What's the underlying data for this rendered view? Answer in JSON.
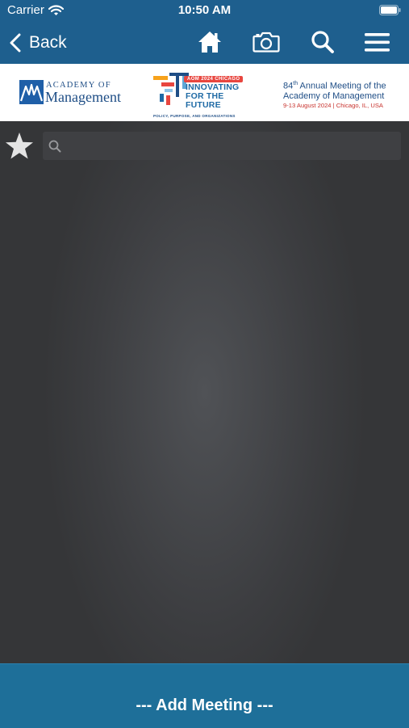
{
  "status_bar": {
    "carrier": "Carrier",
    "time": "10:50 AM",
    "wifi_icon": "wifi-icon",
    "battery_icon": "battery-icon"
  },
  "nav": {
    "back_label": "Back",
    "icons": [
      "chevron-left-icon",
      "home-icon",
      "camera-icon",
      "search-icon",
      "menu-icon"
    ]
  },
  "banner": {
    "aom_logo": {
      "line1": "ACADEMY OF",
      "line2": "Management"
    },
    "conference_logo": {
      "tag": "AOM 2024 CHICAGO",
      "line1": "INNOVATING",
      "line2": "FOR THE",
      "line3": "FUTURE",
      "subtitle": "POLICY, PURPOSE, AND ORGANIZATIONS"
    },
    "meeting_info": {
      "ordinal_number": "84",
      "ordinal_suffix": "th",
      "line1_rest": " Annual Meeting of the",
      "line2": "Academy of Management",
      "line3": "9-13 August 2024 | Chicago, IL, USA"
    }
  },
  "search": {
    "value": "",
    "placeholder": ""
  },
  "bottom": {
    "add_meeting_label": "--- Add Meeting ---"
  },
  "colors": {
    "nav_blue": "#1e5f8e",
    "bottom_blue": "#1e6f99",
    "content_bg": "#3a3b3e",
    "brand_blue": "#1f4e86",
    "accent_red": "#c8332e"
  }
}
